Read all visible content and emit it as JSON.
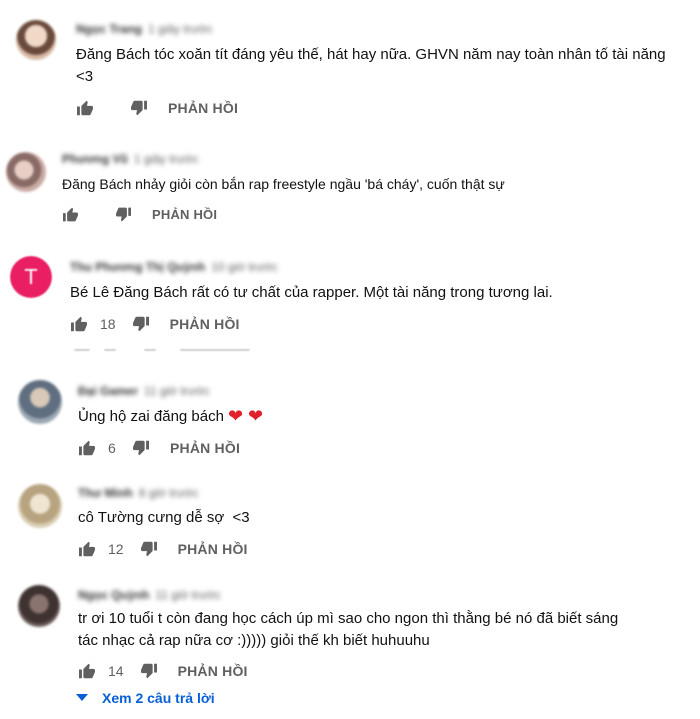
{
  "comments": [
    {
      "author": "Ngọc Trang",
      "time": "1 giây trước",
      "text": "Đăng Bách tóc xoăn tít đáng yêu thế, hát hay nữa. GHVN năm nay toàn nhân tố tài năng <3",
      "likes": "",
      "reply_label": "PHẢN HỒI",
      "avatar_color": "#d9b8a3"
    },
    {
      "author": "Phương Vũ",
      "time": "1 giây trước",
      "text": "Đăng Bách nhảy giỏi còn bắn rap freestyle ngầu 'bá cháy', cuốn thật sự",
      "likes": "",
      "reply_label": "PHẢN HỒI",
      "avatar_color": "#b89a92"
    },
    {
      "author": "Thu Phương Thị Quỳnh",
      "time": "10 giờ trước",
      "text": "Bé Lê Đăng Bách rất có tư chất của rapper. Một tài năng trong tương lai.",
      "likes": "18",
      "reply_label": "PHẢN HỒI",
      "avatar_color": "#e91e63",
      "avatar_letter": "T"
    },
    {
      "author": "Đại Gamer",
      "time": "11 giờ trước",
      "text": "Ủng hộ zai đăng bách",
      "hearts": "❤ ❤",
      "likes": "6",
      "reply_label": "PHẢN HỒI",
      "avatar_color": "#7d8c9c"
    },
    {
      "author": "Thư Minh",
      "time": "8 giờ trước",
      "text": "cô Tường cưng dễ sợ  <3",
      "likes": "12",
      "reply_label": "PHẢN HỒI",
      "avatar_color": "#c8b79a"
    },
    {
      "author": "Ngọc Quỳnh",
      "time": "11 giờ trước",
      "text": "tr ơi 10 tuổi t còn đang học cách úp mì sao cho ngon thì thằng bé nó đã biết sáng tác nhạc cả rap nữa cơ :))))) giỏi thế kh biết huhuuhu",
      "likes": "14",
      "reply_label": "PHẢN HỒI",
      "avatar_color": "#5a4a48"
    }
  ],
  "view_replies": "Xem 2 câu trả lời",
  "colors": {
    "link": "#065fd4",
    "secondary": "#606060",
    "heart": "#e0202a"
  },
  "icons": {
    "like": "thumb-up-icon",
    "dislike": "thumb-down-icon",
    "expand": "caret-down-icon"
  }
}
